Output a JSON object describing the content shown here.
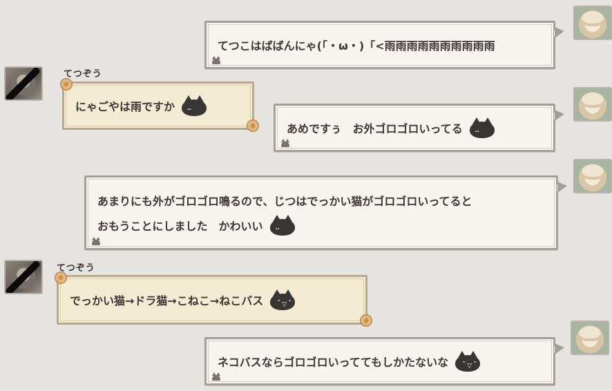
{
  "messages": [
    {
      "id": "m1",
      "side": "right",
      "text": "てつこはばばんにゃ(「・ω・)「<雨雨雨雨雨雨雨雨雨雨"
    },
    {
      "id": "m2",
      "side": "left",
      "sender": "てつぞう",
      "text": "にゃごやは雨ですか",
      "sticker": "cat-sticker"
    },
    {
      "id": "m3",
      "side": "right",
      "text": "あめですぅ　お外ゴロゴロいってる",
      "sticker": "cat-sticker"
    },
    {
      "id": "m4",
      "side": "right",
      "lines": [
        "あまりにも外がゴロゴロ鳴るので、じつはでっかい猫がゴロゴロいってると",
        "おもうことにしました　かわいい"
      ],
      "sticker": "cat-sticker"
    },
    {
      "id": "m5",
      "side": "left",
      "sender": "てつぞう",
      "text": "でっかい猫→ドラ猫→こねこ→ねこバス",
      "sticker": "party-cat-sticker"
    },
    {
      "id": "m6",
      "side": "right",
      "text": "ネコバスならゴロゴロいっててもしかたないな",
      "sticker": "party-cat-sticker"
    }
  ],
  "colors": {
    "background": "#e6e4e0",
    "my_bubble": "#f7f3ee",
    "their_bubble": "#f3ecd2"
  }
}
